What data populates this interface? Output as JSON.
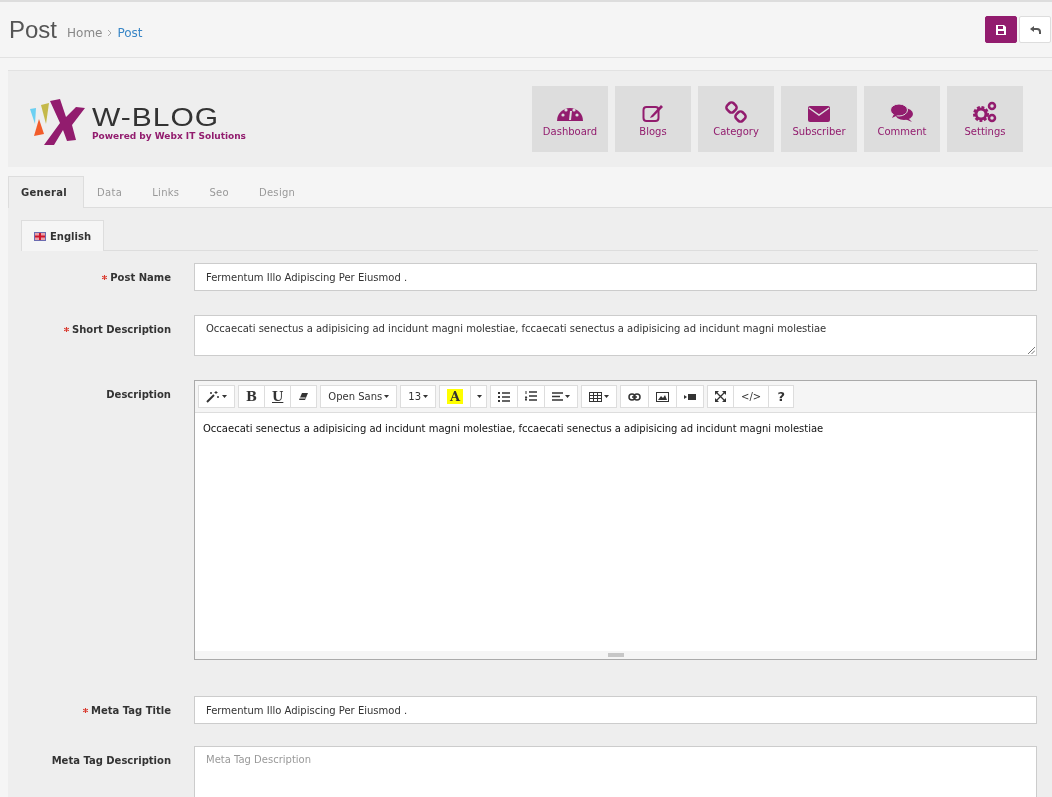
{
  "page": {
    "title": "Post",
    "breadcrumb": [
      {
        "label": "Home",
        "current": false
      },
      {
        "label": "Post",
        "current": true
      }
    ]
  },
  "header_buttons": [
    {
      "kind": "save"
    },
    {
      "kind": "back"
    }
  ],
  "logo": {
    "wordmark": "W-BLOG",
    "tagline": "Powered by Webx IT Solutions"
  },
  "nav_tiles": [
    {
      "kind": "dashboard",
      "label": "Dashboard"
    },
    {
      "kind": "blogs",
      "label": "Blogs"
    },
    {
      "kind": "category",
      "label": "Category"
    },
    {
      "kind": "subscriber",
      "label": "Subscriber"
    },
    {
      "kind": "comment",
      "label": "Comment"
    },
    {
      "kind": "settings",
      "label": "Settings"
    }
  ],
  "tabs": [
    {
      "label": "General",
      "selected": true
    },
    {
      "label": "Data",
      "selected": false
    },
    {
      "label": "Links",
      "selected": false
    },
    {
      "label": "Seo",
      "selected": false
    },
    {
      "label": "Design",
      "selected": false
    }
  ],
  "language_tabs": [
    {
      "label": "English",
      "selected": true
    }
  ],
  "fields": [
    {
      "kind": "text",
      "label": "Post Name",
      "required": true,
      "value": "Fermentum Illo Adipiscing Per Eiusmod ."
    },
    {
      "kind": "textarea",
      "label": "Short Description",
      "required": true,
      "value": "Occaecati senectus a adipisicing ad incidunt magni molestiae, fccaecati senectus a adipisicing ad incidunt magni molestiae"
    },
    {
      "kind": "editor",
      "label": "Description",
      "required": false,
      "value": "Occaecati senectus a adipisicing ad incidunt magni molestiae, fccaecati senectus a adipisicing ad incidunt magni molestiae",
      "toolbar": [
        [
          {
            "kind": "magic",
            "dropdown": true
          }
        ],
        [
          {
            "kind": "bold",
            "text": "B"
          },
          {
            "kind": "underline",
            "text": "U"
          },
          {
            "kind": "eraser"
          }
        ],
        [
          {
            "kind": "font",
            "text": "Open Sans",
            "dropdown": true
          }
        ],
        [
          {
            "kind": "size",
            "text": "13",
            "dropdown": true
          }
        ],
        [
          {
            "kind": "color",
            "text": "A"
          },
          {
            "kind": "caret",
            "dropdown": true
          }
        ],
        [
          {
            "kind": "ul"
          },
          {
            "kind": "ol"
          },
          {
            "kind": "align",
            "dropdown": true
          }
        ],
        [
          {
            "kind": "table",
            "dropdown": true
          }
        ],
        [
          {
            "kind": "link"
          },
          {
            "kind": "picture"
          },
          {
            "kind": "video"
          }
        ],
        [
          {
            "kind": "fullscreen"
          },
          {
            "kind": "code",
            "text": "</>"
          },
          {
            "kind": "help",
            "text": "?"
          }
        ]
      ]
    },
    {
      "kind": "text",
      "label": "Meta Tag Title",
      "required": true,
      "value": "Fermentum Illo Adipiscing Per Eiusmod ."
    },
    {
      "kind": "textarea",
      "label": "Meta Tag Description",
      "required": false,
      "placeholder": "Meta Tag Description"
    }
  ]
}
